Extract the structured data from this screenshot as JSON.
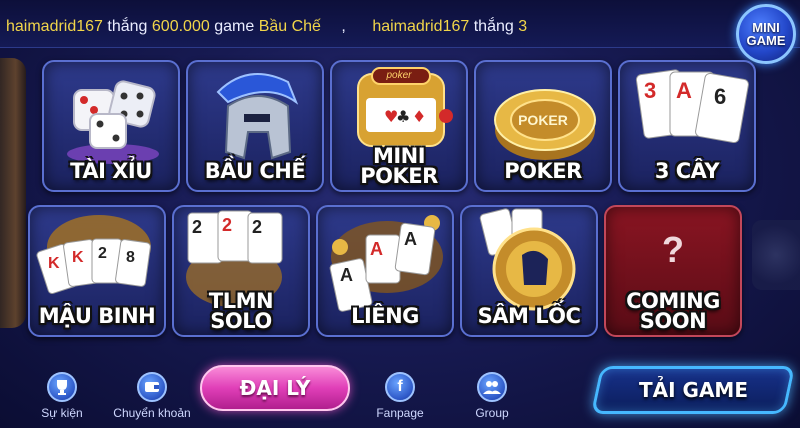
{
  "ticker": [
    {
      "user": "haimadrid167",
      "verb": "thắng",
      "amount": "600.000",
      "word": "game",
      "game": "Bầu Chế"
    },
    {
      "user": "haimadrid167",
      "verb": "thắng",
      "amount": "3"
    }
  ],
  "ticker_separator": ",",
  "mini_game": {
    "line1": "MINI",
    "line2": "GAME"
  },
  "games": [
    {
      "label": "TÀI XỈU",
      "icon": "dice-icon"
    },
    {
      "label": "BẦU CHẾ",
      "icon": "spartan-helmet-icon"
    },
    {
      "label": "MINI POKER",
      "line1": "MINI",
      "line2": "POKER",
      "icon": "slot-machine-icon"
    },
    {
      "label": "POKER",
      "icon": "poker-chip-icon"
    },
    {
      "label": "3 CÂY",
      "icon": "playing-cards-icon",
      "cards": [
        "3",
        "A",
        "6"
      ]
    },
    {
      "label": "MẬU BINH",
      "icon": "card-fan-icon",
      "cards": [
        "K",
        "K",
        "2",
        "8"
      ]
    },
    {
      "label": "TLMN SOLO",
      "line1": "TLMN",
      "line2": "SOLO",
      "icon": "playing-cards-icon",
      "cards": [
        "2",
        "2",
        "2"
      ]
    },
    {
      "label": "LIÊNG",
      "icon": "aces-icon",
      "cards": [
        "A",
        "A",
        "A"
      ]
    },
    {
      "label": "SÂM LỐC",
      "icon": "spartan-coin-icon"
    },
    {
      "label": "COMING SOON",
      "line1": "COMING",
      "line2": "SOON",
      "mark": "?",
      "icon": "question-icon"
    }
  ],
  "poker_chip_text": "POKER",
  "slot_sign": "poker",
  "bottom_nav": [
    {
      "label": "Sự kiện",
      "icon": "trophy-icon"
    },
    {
      "label": "Chuyển khoản",
      "icon": "wallet-icon"
    },
    {
      "label": "Fanpage",
      "icon": "facebook-icon",
      "glyph": "f"
    },
    {
      "label": "Group",
      "icon": "group-icon"
    }
  ],
  "agent_button": "ĐẠI LÝ",
  "download_button": "TẢI GAME",
  "colors": {
    "accent_yellow": "#f1d54a",
    "agent_pink": "#e03fb8",
    "download_border": "#46b8ff",
    "tile_border": "#5a6fd0"
  }
}
